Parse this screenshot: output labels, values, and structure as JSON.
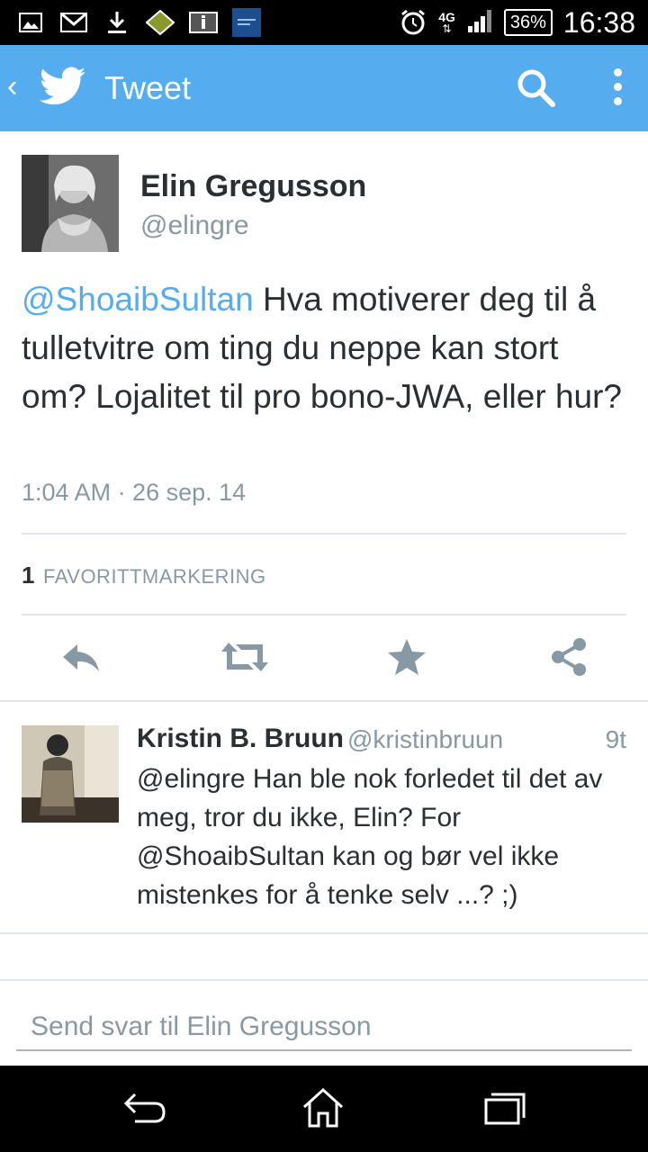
{
  "status_bar": {
    "network": "4G",
    "battery": "36%",
    "time": "16:38"
  },
  "app_bar": {
    "back_label": "‹",
    "title": "Tweet"
  },
  "tweet": {
    "author_name": "Elin Gregusson",
    "author_handle": "@elingre",
    "mention": "@ShoaibSultan",
    "text": " Hva motiverer deg til å tulletvitre om ting du neppe kan stort om? Lojalitet til pro bono-JWA, eller hur?",
    "timestamp": "1:04 AM · 26 sep. 14",
    "favorite_count": "1",
    "favorite_label": "FAVORITTMARKERING"
  },
  "reply": {
    "author_name": "Kristin B. Bruun",
    "author_handle": "@kristinbruun",
    "age": "9t",
    "text": "@elingre Han ble nok forledet til det av meg, tror du ikke,  Elin? For @ShoaibSultan kan og bør vel ikke mistenkes for å tenke selv ...? ;)"
  },
  "compose": {
    "placeholder": "Send svar til Elin Gregusson"
  },
  "colors": {
    "brand": "#55acee",
    "text": "#292f33",
    "muted": "#8899a6",
    "divider": "#e1e8ed",
    "action_icon": "#8899a6"
  },
  "icons": {
    "back": "chevron-left-icon",
    "brand": "twitter-bird-icon",
    "search": "search-icon",
    "more": "more-vertical-icon",
    "reply": "reply-icon",
    "retweet": "retweet-icon",
    "favorite": "star-icon",
    "share": "share-icon"
  }
}
